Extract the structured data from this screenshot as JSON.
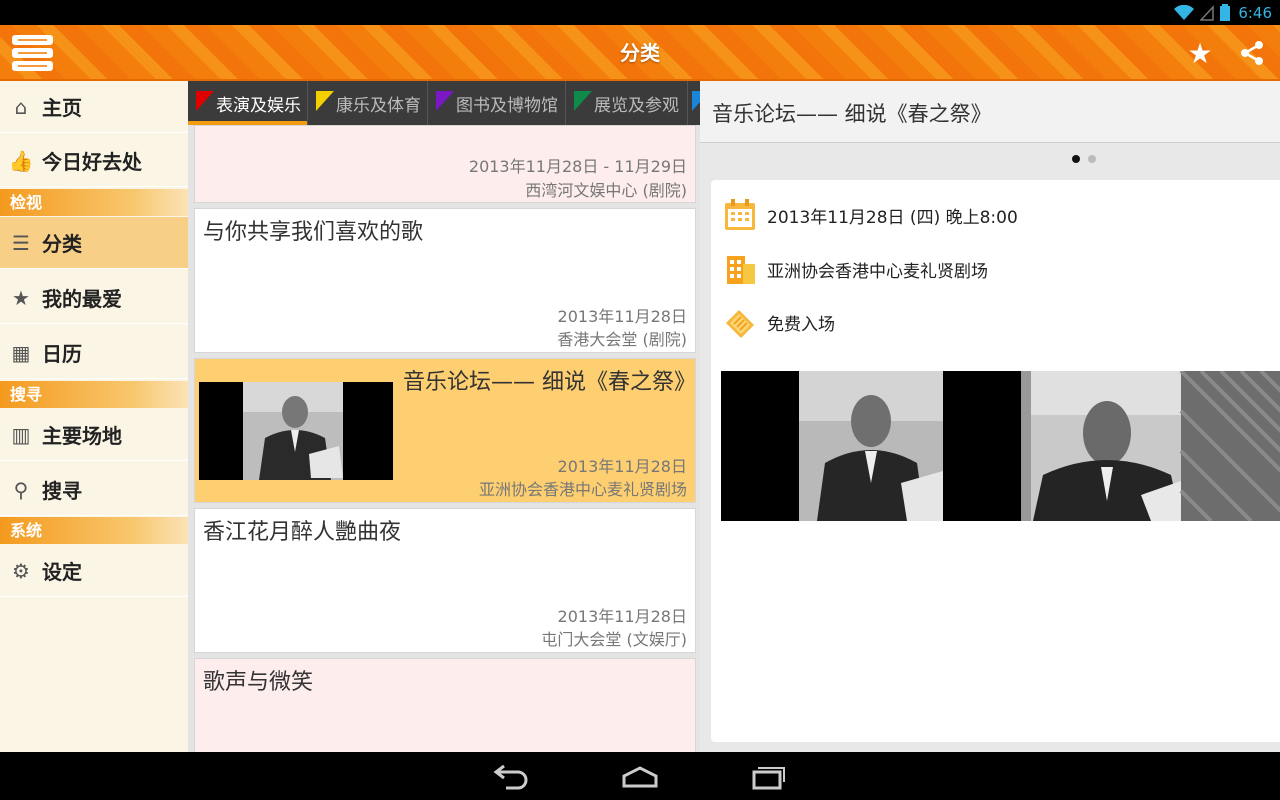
{
  "status": {
    "time": "6:46"
  },
  "actionbar": {
    "title": "分类",
    "menu_icon": "menu-icon",
    "star_icon": "star-icon",
    "share_icon": "share-icon"
  },
  "nav": {
    "items": [
      {
        "label": "主页",
        "icon": "home-icon"
      },
      {
        "label": "今日好去处",
        "icon": "thumbs-up-icon"
      },
      {
        "label": "分类",
        "icon": "list-icon"
      },
      {
        "label": "我的最爱",
        "icon": "star-icon"
      },
      {
        "label": "日历",
        "icon": "calendar-icon"
      },
      {
        "label": "主要场地",
        "icon": "building-icon"
      },
      {
        "label": "搜寻",
        "icon": "search-icon"
      },
      {
        "label": "设定",
        "icon": "gear-icon"
      }
    ],
    "headers": {
      "browse": "检视",
      "search": "搜寻",
      "system": "系统"
    }
  },
  "tabs": [
    {
      "label": "表演及娱乐",
      "color": "#e10000"
    },
    {
      "label": "康乐及体育",
      "color": "#f5d000"
    },
    {
      "label": "图书及博物馆",
      "color": "#7a18c6"
    },
    {
      "label": "展览及参观",
      "color": "#0f8a4a"
    },
    {
      "label": "",
      "color": "#1a86d8"
    }
  ],
  "events": [
    {
      "title": "",
      "date": "2013年11月28日 - 11月29日",
      "venue": "西湾河文娱中心 (剧院)"
    },
    {
      "title": "与你共享我们喜欢的歌",
      "date": "2013年11月28日",
      "venue": "香港大会堂 (剧院)"
    },
    {
      "title": "音乐论坛—— 细说《春之祭》",
      "date": "2013年11月28日",
      "venue": "亚洲协会香港中心麦礼贤剧场"
    },
    {
      "title": "香江花月醉人艷曲夜",
      "date": "2013年11月28日",
      "venue": "屯门大会堂 (文娱厅)"
    },
    {
      "title": "歌声与微笑",
      "date": "",
      "venue": ""
    }
  ],
  "detail": {
    "title": "音乐论坛—— 细说《春之祭》",
    "datetime": "2013年11月28日 (四) 晚上8:00",
    "venue": "亚洲协会香港中心麦礼贤剧场",
    "admission": "免费入场"
  },
  "colors": {
    "accent": "#f47e0c",
    "selected": "#f7cf86",
    "highlight_card": "#fecf71",
    "pink_card": "#fdeeed"
  }
}
